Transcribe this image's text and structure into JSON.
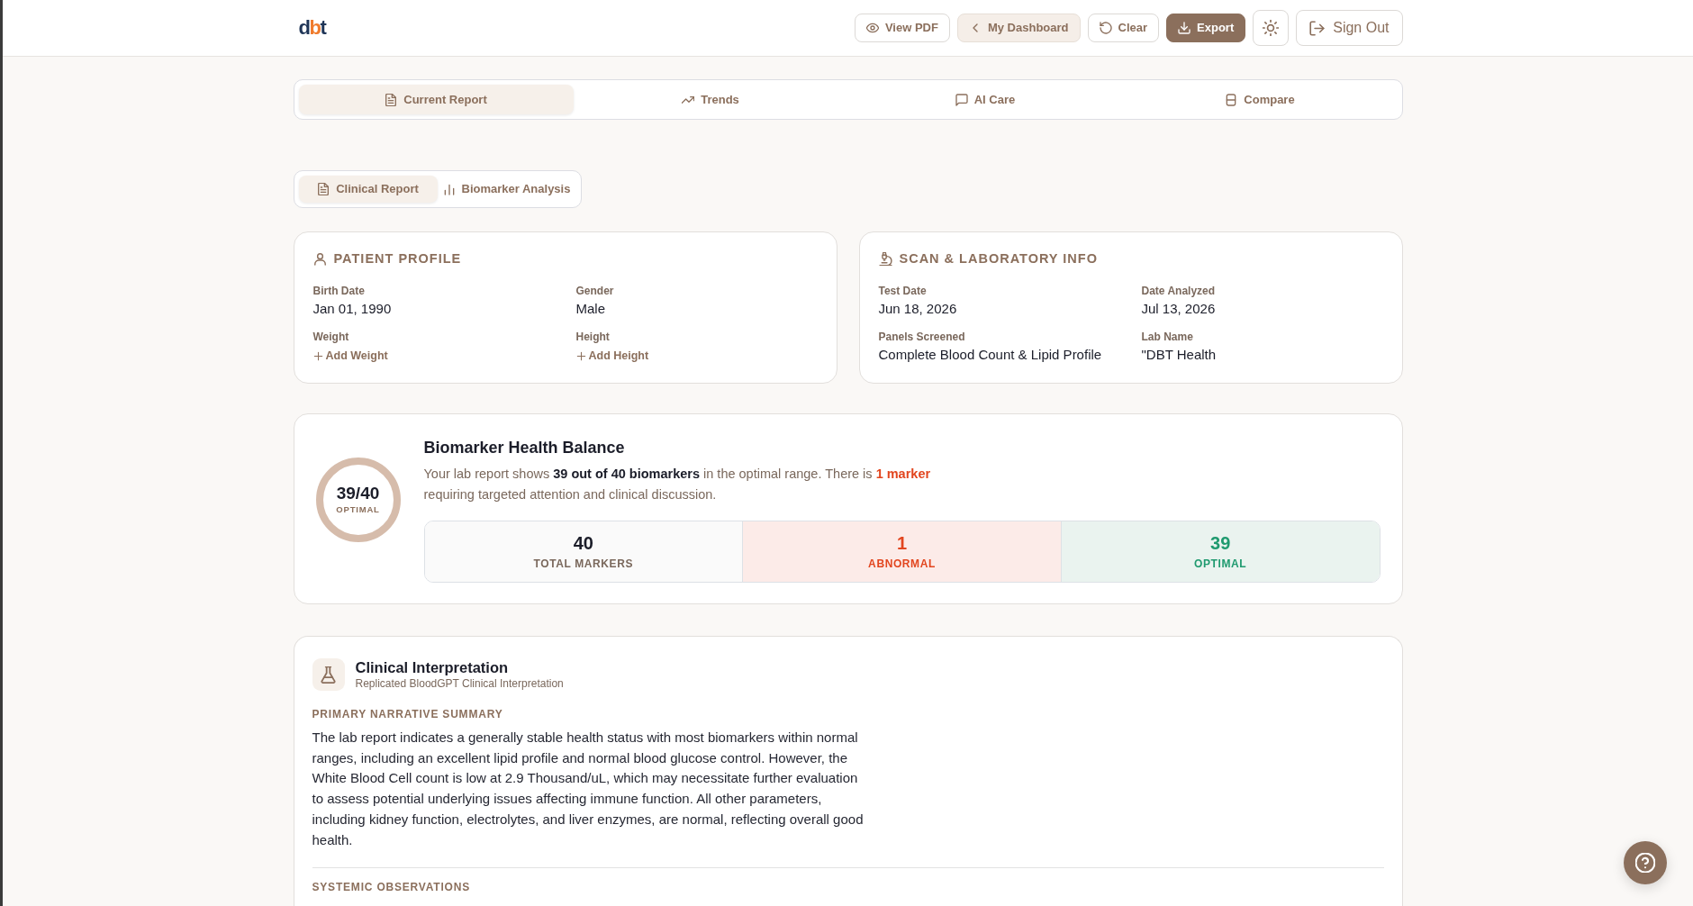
{
  "header": {
    "logo": {
      "parts": [
        {
          "text": "d",
          "color": "#1f3557"
        },
        {
          "text": "b",
          "color": "#f07b2c"
        },
        {
          "text": "t",
          "color": "#1f3557"
        }
      ]
    },
    "buttons": [
      {
        "kind": "outline",
        "label": "View PDF"
      },
      {
        "kind": "tinted",
        "label": "My Dashboard"
      },
      {
        "kind": "outline",
        "label": "Clear"
      },
      {
        "kind": "filled",
        "label": "Export"
      },
      {
        "kind": "icon"
      },
      {
        "kind": "large",
        "label": "Sign Out"
      }
    ]
  },
  "main_tabs": [
    {
      "label": "Current Report",
      "selected": true
    },
    {
      "label": "Trends",
      "selected": false
    },
    {
      "label": "AI Care",
      "selected": false
    },
    {
      "label": "Compare",
      "selected": false
    }
  ],
  "sub_tabs": [
    {
      "label": "Clinical Report",
      "selected": true
    },
    {
      "label": "Biomarker Analysis",
      "selected": false
    }
  ],
  "info_cards": [
    {
      "title": "PATIENT PROFILE",
      "fields": [
        {
          "kind": "value",
          "label": "Birth Date",
          "value": "Jan 01, 1990"
        },
        {
          "kind": "value",
          "label": "Gender",
          "value": "Male"
        },
        {
          "kind": "add",
          "label": "Weight",
          "action": "Add Weight"
        },
        {
          "kind": "add",
          "label": "Height",
          "action": "Add Height"
        }
      ]
    },
    {
      "title": "SCAN & LABORATORY INFO",
      "fields": [
        {
          "kind": "value",
          "label": "Test Date",
          "value": "Jun 18, 2026"
        },
        {
          "kind": "value",
          "label": "Date Analyzed",
          "value": "Jul 13, 2026"
        },
        {
          "kind": "value",
          "label": "Panels Screened",
          "value": "Complete Blood Count & Lipid Profile"
        },
        {
          "kind": "value",
          "label": "Lab Name",
          "value": "\"DBT Health"
        }
      ]
    }
  ],
  "health_balance": {
    "score": "39/40",
    "score_label": "OPTIMAL",
    "title": "Biomarker Health Balance",
    "summary": [
      {
        "kind": "plain",
        "text": "Your lab report shows "
      },
      {
        "kind": "strong",
        "text": "39 out of 40 biomarkers"
      },
      {
        "kind": "plain",
        "text": " in the optimal range. There is "
      },
      {
        "kind": "alert",
        "text": "1 marker"
      },
      {
        "kind": "plain",
        "text": " requiring targeted attention and clinical discussion."
      }
    ],
    "stats": [
      {
        "kind": "total",
        "value": "40",
        "label": "TOTAL MARKERS"
      },
      {
        "kind": "abnormal",
        "value": "1",
        "label": "ABNORMAL"
      },
      {
        "kind": "optimal",
        "value": "39",
        "label": "OPTIMAL"
      }
    ]
  },
  "clinical_interpretation": {
    "title": "Clinical Interpretation",
    "subtitle": "Replicated BloodGPT Clinical Interpretation",
    "sections": [
      {
        "heading": "PRIMARY NARRATIVE SUMMARY",
        "text": "The lab report indicates a generally stable health status with most biomarkers within normal ranges, including an excellent lipid profile and normal blood glucose control. However, the White Blood Cell count is low at 2.9 Thousand/uL, which may necessitate further evaluation to assess potential underlying issues affecting immune function. All other parameters, including kidney function, electrolytes, and liver enzymes, are normal, reflecting overall good health."
      },
      {
        "heading": "SYSTEMIC OBSERVATIONS"
      }
    ]
  }
}
